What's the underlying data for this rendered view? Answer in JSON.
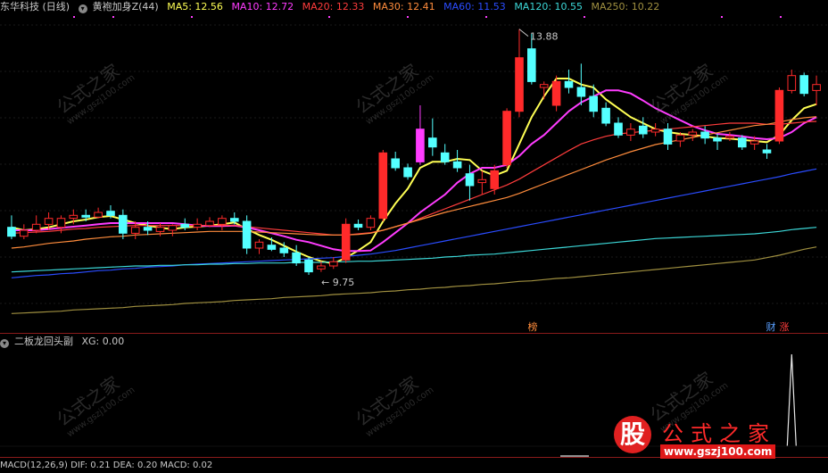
{
  "main_header": {
    "stock_name": "东华科技 (日线)",
    "indicator_name": "黄袍加身Z(44)",
    "ma": [
      {
        "label": "MA5: 12.56",
        "color": "#ffff54"
      },
      {
        "label": "MA10: 12.72",
        "color": "#ff3cff"
      },
      {
        "label": "MA20: 12.33",
        "color": "#ff3c3c"
      },
      {
        "label": "MA30: 12.41",
        "color": "#ff8c3c"
      },
      {
        "label": "MA60: 11.53",
        "color": "#2a4cff"
      },
      {
        "label": "MA120: 10.55",
        "color": "#3cd8d8"
      },
      {
        "label": "MA250: 10.22",
        "color": "#a09040"
      }
    ]
  },
  "sub_header": {
    "indicator_name": "二板龙回头副",
    "value_label": "XG: 0.00"
  },
  "bottom_header": {
    "text": "MACD(12,26,9)  DIF: 0.21  DEA: 0.20  MACD: 0.02"
  },
  "annotations": {
    "high_label": "13.88",
    "low_label": "9.75",
    "tag_bang": "榜",
    "tag_cai": "财",
    "tag_zhang": "涨"
  },
  "watermark": {
    "text": "公式之家",
    "url": "www.gszj100.com",
    "brand_glyph": "股"
  },
  "colors": {
    "up": "#ff2a2a",
    "down": "#54ffff",
    "magenta_bar": "#ff3cff"
  },
  "chart_data": {
    "type": "candlestick",
    "y_range": [
      9.0,
      14.1
    ],
    "candles": [
      {
        "o": 10.55,
        "h": 10.75,
        "l": 10.35,
        "c": 10.4
      },
      {
        "o": 10.4,
        "h": 10.6,
        "l": 10.35,
        "c": 10.5
      },
      {
        "o": 10.5,
        "h": 10.75,
        "l": 10.45,
        "c": 10.6
      },
      {
        "o": 10.6,
        "h": 10.8,
        "l": 10.5,
        "c": 10.7
      },
      {
        "o": 10.55,
        "h": 10.75,
        "l": 10.45,
        "c": 10.7
      },
      {
        "o": 10.7,
        "h": 10.85,
        "l": 10.6,
        "c": 10.75
      },
      {
        "o": 10.75,
        "h": 10.85,
        "l": 10.65,
        "c": 10.72
      },
      {
        "o": 10.72,
        "h": 10.88,
        "l": 10.7,
        "c": 10.8
      },
      {
        "o": 10.82,
        "h": 10.92,
        "l": 10.7,
        "c": 10.75
      },
      {
        "o": 10.75,
        "h": 10.85,
        "l": 10.35,
        "c": 10.45
      },
      {
        "o": 10.45,
        "h": 10.65,
        "l": 10.35,
        "c": 10.55
      },
      {
        "o": 10.55,
        "h": 10.65,
        "l": 10.42,
        "c": 10.5
      },
      {
        "o": 10.48,
        "h": 10.62,
        "l": 10.4,
        "c": 10.55
      },
      {
        "o": 10.5,
        "h": 10.6,
        "l": 10.4,
        "c": 10.58
      },
      {
        "o": 10.6,
        "h": 10.7,
        "l": 10.5,
        "c": 10.55
      },
      {
        "o": 10.55,
        "h": 10.7,
        "l": 10.5,
        "c": 10.6
      },
      {
        "o": 10.58,
        "h": 10.72,
        "l": 10.55,
        "c": 10.65
      },
      {
        "o": 10.6,
        "h": 10.75,
        "l": 10.5,
        "c": 10.7
      },
      {
        "o": 10.7,
        "h": 10.8,
        "l": 10.6,
        "c": 10.65
      },
      {
        "o": 10.65,
        "h": 10.75,
        "l": 10.1,
        "c": 10.2
      },
      {
        "o": 10.2,
        "h": 10.35,
        "l": 10.1,
        "c": 10.3
      },
      {
        "o": 10.25,
        "h": 10.38,
        "l": 10.15,
        "c": 10.18
      },
      {
        "o": 10.2,
        "h": 10.3,
        "l": 10.05,
        "c": 10.12
      },
      {
        "o": 10.12,
        "h": 10.25,
        "l": 9.9,
        "c": 9.95
      },
      {
        "o": 10.0,
        "h": 10.05,
        "l": 9.75,
        "c": 9.8
      },
      {
        "o": 9.85,
        "h": 9.98,
        "l": 9.8,
        "c": 9.9
      },
      {
        "o": 9.9,
        "h": 10.05,
        "l": 9.85,
        "c": 9.97
      },
      {
        "o": 10.0,
        "h": 10.7,
        "l": 9.95,
        "c": 10.6
      },
      {
        "o": 10.6,
        "h": 10.68,
        "l": 10.5,
        "c": 10.55
      },
      {
        "o": 10.55,
        "h": 10.75,
        "l": 10.5,
        "c": 10.7
      },
      {
        "o": 10.7,
        "h": 11.85,
        "l": 10.65,
        "c": 11.8
      },
      {
        "o": 11.7,
        "h": 11.82,
        "l": 11.5,
        "c": 11.55
      },
      {
        "o": 11.55,
        "h": 11.62,
        "l": 11.35,
        "c": 11.4
      },
      {
        "o": 11.65,
        "h": 12.6,
        "l": 11.6,
        "c": 12.2
      },
      {
        "o": 12.05,
        "h": 12.38,
        "l": 11.75,
        "c": 11.9
      },
      {
        "o": 11.8,
        "h": 11.95,
        "l": 11.6,
        "c": 11.65
      },
      {
        "o": 11.65,
        "h": 11.85,
        "l": 11.48,
        "c": 11.55
      },
      {
        "o": 11.45,
        "h": 11.6,
        "l": 11.0,
        "c": 11.25
      },
      {
        "o": 11.3,
        "h": 11.5,
        "l": 11.1,
        "c": 11.35
      },
      {
        "o": 11.2,
        "h": 11.6,
        "l": 11.1,
        "c": 11.5
      },
      {
        "o": 11.6,
        "h": 12.55,
        "l": 11.55,
        "c": 12.5
      },
      {
        "o": 12.5,
        "h": 13.88,
        "l": 12.4,
        "c": 13.4
      },
      {
        "o": 13.55,
        "h": 13.8,
        "l": 12.95,
        "c": 13.0
      },
      {
        "o": 12.9,
        "h": 13.0,
        "l": 12.7,
        "c": 12.95
      },
      {
        "o": 12.6,
        "h": 13.1,
        "l": 12.5,
        "c": 13.0
      },
      {
        "o": 13.0,
        "h": 13.2,
        "l": 12.8,
        "c": 12.9
      },
      {
        "o": 12.9,
        "h": 13.3,
        "l": 12.6,
        "c": 12.75
      },
      {
        "o": 12.75,
        "h": 12.95,
        "l": 12.4,
        "c": 12.5
      },
      {
        "o": 12.55,
        "h": 12.65,
        "l": 12.25,
        "c": 12.3
      },
      {
        "o": 12.3,
        "h": 12.4,
        "l": 12.05,
        "c": 12.1
      },
      {
        "o": 12.1,
        "h": 12.3,
        "l": 12.0,
        "c": 12.2
      },
      {
        "o": 12.25,
        "h": 12.4,
        "l": 12.05,
        "c": 12.12
      },
      {
        "o": 12.15,
        "h": 12.3,
        "l": 12.08,
        "c": 12.2
      },
      {
        "o": 12.2,
        "h": 12.3,
        "l": 11.85,
        "c": 11.95
      },
      {
        "o": 12.0,
        "h": 12.15,
        "l": 11.9,
        "c": 12.1
      },
      {
        "o": 12.1,
        "h": 12.2,
        "l": 12.0,
        "c": 12.15
      },
      {
        "o": 12.15,
        "h": 12.25,
        "l": 11.95,
        "c": 12.05
      },
      {
        "o": 12.05,
        "h": 12.12,
        "l": 11.85,
        "c": 12.0
      },
      {
        "o": 12.05,
        "h": 12.15,
        "l": 12.0,
        "c": 12.08
      },
      {
        "o": 12.05,
        "h": 12.1,
        "l": 11.85,
        "c": 11.9
      },
      {
        "o": 11.95,
        "h": 12.08,
        "l": 11.85,
        "c": 12.0
      },
      {
        "o": 11.85,
        "h": 11.95,
        "l": 11.7,
        "c": 11.8
      },
      {
        "o": 12.0,
        "h": 12.9,
        "l": 11.95,
        "c": 12.85
      },
      {
        "o": 12.85,
        "h": 13.2,
        "l": 12.8,
        "c": 13.1
      },
      {
        "o": 13.1,
        "h": 13.15,
        "l": 12.75,
        "c": 12.8
      },
      {
        "o": 12.85,
        "h": 13.1,
        "l": 12.6,
        "c": 12.95
      }
    ],
    "magenta_bar_indices": [
      33
    ],
    "ma_series": [
      {
        "name": "MA5",
        "color": "#ffff54",
        "values": [
          10.55,
          10.5,
          10.52,
          10.55,
          10.6,
          10.65,
          10.68,
          10.72,
          10.74,
          10.68,
          10.62,
          10.58,
          10.54,
          10.52,
          10.55,
          10.56,
          10.58,
          10.6,
          10.63,
          10.52,
          10.42,
          10.34,
          10.24,
          10.14,
          10.05,
          9.98,
          9.94,
          10.04,
          10.16,
          10.3,
          10.65,
          10.95,
          11.2,
          11.55,
          11.65,
          11.65,
          11.7,
          11.68,
          11.5,
          11.42,
          11.5,
          11.95,
          12.4,
          12.75,
          13.05,
          13.05,
          12.95,
          12.9,
          12.7,
          12.55,
          12.4,
          12.3,
          12.2,
          12.15,
          12.12,
          12.1,
          12.08,
          12.05,
          12.04,
          12.02,
          12.0,
          11.98,
          12.1,
          12.35,
          12.55,
          12.62
        ]
      },
      {
        "name": "MA10",
        "color": "#ff3cff",
        "values": [
          10.5,
          10.5,
          10.5,
          10.52,
          10.54,
          10.56,
          10.58,
          10.6,
          10.62,
          10.62,
          10.62,
          10.62,
          10.62,
          10.62,
          10.6,
          10.58,
          10.57,
          10.57,
          10.58,
          10.55,
          10.5,
          10.45,
          10.4,
          10.34,
          10.3,
          10.24,
          10.18,
          10.15,
          10.15,
          10.16,
          10.3,
          10.46,
          10.62,
          10.8,
          10.95,
          11.1,
          11.3,
          11.45,
          11.55,
          11.55,
          11.6,
          11.75,
          11.95,
          12.1,
          12.3,
          12.5,
          12.65,
          12.75,
          12.85,
          12.85,
          12.8,
          12.68,
          12.55,
          12.45,
          12.35,
          12.25,
          12.18,
          12.12,
          12.1,
          12.08,
          12.05,
          12.03,
          12.05,
          12.15,
          12.3,
          12.4
        ]
      },
      {
        "name": "MA20",
        "color": "#ff3c3c",
        "values": [
          10.45,
          10.46,
          10.47,
          10.48,
          10.5,
          10.52,
          10.53,
          10.55,
          10.56,
          10.57,
          10.58,
          10.58,
          10.58,
          10.58,
          10.58,
          10.58,
          10.58,
          10.58,
          10.58,
          10.56,
          10.54,
          10.52,
          10.5,
          10.48,
          10.46,
          10.44,
          10.42,
          10.42,
          10.44,
          10.46,
          10.5,
          10.56,
          10.62,
          10.7,
          10.78,
          10.86,
          10.94,
          11.02,
          11.1,
          11.18,
          11.26,
          11.36,
          11.48,
          11.6,
          11.72,
          11.84,
          11.95,
          12.02,
          12.08,
          12.12,
          12.14,
          12.16,
          12.18,
          12.2,
          12.22,
          12.24,
          12.26,
          12.28,
          12.3,
          12.3,
          12.3,
          12.28,
          12.28,
          12.3,
          12.32,
          12.33
        ]
      },
      {
        "name": "MA30",
        "color": "#ff8c3c",
        "values": [
          10.2,
          10.22,
          10.25,
          10.28,
          10.3,
          10.32,
          10.35,
          10.37,
          10.39,
          10.4,
          10.42,
          10.43,
          10.44,
          10.45,
          10.46,
          10.47,
          10.48,
          10.48,
          10.48,
          10.48,
          10.47,
          10.46,
          10.45,
          10.44,
          10.43,
          10.42,
          10.42,
          10.42,
          10.43,
          10.45,
          10.5,
          10.56,
          10.62,
          10.68,
          10.74,
          10.8,
          10.85,
          10.9,
          10.95,
          11.0,
          11.05,
          11.12,
          11.2,
          11.28,
          11.36,
          11.44,
          11.52,
          11.6,
          11.68,
          11.75,
          11.82,
          11.88,
          11.94,
          11.98,
          12.02,
          12.06,
          12.1,
          12.14,
          12.18,
          12.22,
          12.26,
          12.28,
          12.32,
          12.36,
          12.39,
          12.41
        ]
      },
      {
        "name": "MA60",
        "color": "#2a4cff",
        "values": [
          9.7,
          9.72,
          9.74,
          9.75,
          9.77,
          9.78,
          9.8,
          9.82,
          9.83,
          9.85,
          9.86,
          9.88,
          9.89,
          9.9,
          9.92,
          9.93,
          9.94,
          9.95,
          9.96,
          9.97,
          9.98,
          9.99,
          10.0,
          10.01,
          10.02,
          10.03,
          10.04,
          10.06,
          10.08,
          10.1,
          10.13,
          10.16,
          10.2,
          10.24,
          10.28,
          10.32,
          10.36,
          10.4,
          10.44,
          10.48,
          10.52,
          10.56,
          10.6,
          10.64,
          10.68,
          10.72,
          10.76,
          10.8,
          10.84,
          10.88,
          10.92,
          10.96,
          11.0,
          11.04,
          11.08,
          11.12,
          11.16,
          11.2,
          11.24,
          11.28,
          11.32,
          11.36,
          11.4,
          11.45,
          11.49,
          11.53
        ]
      },
      {
        "name": "MA120",
        "color": "#3cd8d8",
        "values": [
          9.8,
          9.81,
          9.82,
          9.83,
          9.84,
          9.85,
          9.86,
          9.87,
          9.88,
          9.89,
          9.9,
          9.9,
          9.91,
          9.91,
          9.92,
          9.92,
          9.93,
          9.93,
          9.94,
          9.94,
          9.95,
          9.95,
          9.95,
          9.96,
          9.96,
          9.96,
          9.97,
          9.97,
          9.98,
          9.98,
          9.99,
          10.0,
          10.01,
          10.02,
          10.03,
          10.05,
          10.06,
          10.08,
          10.09,
          10.1,
          10.12,
          10.14,
          10.16,
          10.18,
          10.2,
          10.22,
          10.24,
          10.26,
          10.28,
          10.3,
          10.32,
          10.34,
          10.36,
          10.37,
          10.38,
          10.39,
          10.4,
          10.41,
          10.42,
          10.43,
          10.44,
          10.46,
          10.48,
          10.51,
          10.53,
          10.55
        ]
      },
      {
        "name": "MA250",
        "color": "#a09040",
        "values": [
          9.1,
          9.11,
          9.12,
          9.13,
          9.14,
          9.16,
          9.17,
          9.18,
          9.19,
          9.2,
          9.22,
          9.23,
          9.24,
          9.25,
          9.27,
          9.28,
          9.29,
          9.3,
          9.32,
          9.33,
          9.34,
          9.35,
          9.37,
          9.38,
          9.39,
          9.4,
          9.42,
          9.43,
          9.44,
          9.45,
          9.47,
          9.48,
          9.5,
          9.51,
          9.53,
          9.54,
          9.56,
          9.57,
          9.59,
          9.6,
          9.62,
          9.64,
          9.65,
          9.67,
          9.69,
          9.7,
          9.72,
          9.74,
          9.76,
          9.78,
          9.8,
          9.82,
          9.84,
          9.86,
          9.88,
          9.9,
          9.92,
          9.94,
          9.96,
          9.98,
          10.0,
          10.04,
          10.08,
          10.13,
          10.18,
          10.22
        ]
      }
    ],
    "sub_signal": {
      "index": 63,
      "value": 1
    }
  }
}
